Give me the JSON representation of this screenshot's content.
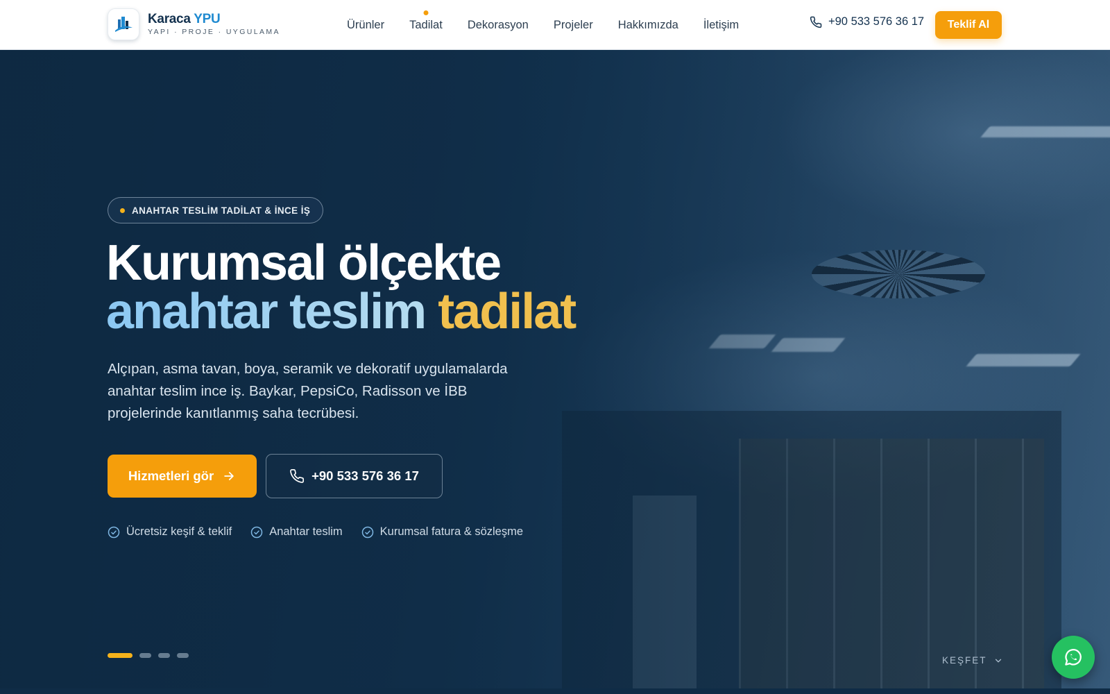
{
  "brand": {
    "name_main": "Karaca",
    "name_accent": "YPU",
    "tagline": "YAPI · PROJE · UYGULAMA",
    "logo_icon": "building-logo-icon"
  },
  "nav": {
    "items": [
      {
        "label": "Ürünler"
      },
      {
        "label": "Tadilat",
        "indicator": true
      },
      {
        "label": "Dekorasyon"
      },
      {
        "label": "Projeler"
      },
      {
        "label": "Hakkımızda"
      },
      {
        "label": "İletişim"
      }
    ]
  },
  "header": {
    "phone": "+90 533 576 36 17",
    "phone_icon": "phone-icon",
    "cta_label": "Teklif Al"
  },
  "hero": {
    "badge": "ANAHTAR TESLİM TADİLAT & İNCE İŞ",
    "title_line1": "Kurumsal ölçekte",
    "title_line2_blue": "anahtar teslim",
    "title_line2_gold": "tadilat",
    "description": "Alçıpan, asma tavan, boya, seramik ve dekoratif uygulamalarda anahtar teslim ince iş. Baykar, PepsiCo, Radisson ve İBB projelerinde kanıtlanmış saha tecrübesi.",
    "primary_button": "Hizmetleri gör",
    "secondary_button": "+90 533 576 36 17",
    "features": [
      "Ücretsiz keşif & teklif",
      "Anahtar teslim",
      "Kurumsal fatura & sözleşme"
    ],
    "slides": {
      "count": 4,
      "active": 1
    },
    "explore_label": "KEŞFET"
  },
  "colors": {
    "accent": "#f59e0b",
    "brand_blue": "#1f8ad0",
    "navy": "#14324f",
    "title_gold": "#f1c04e",
    "whatsapp": "#25c161"
  }
}
